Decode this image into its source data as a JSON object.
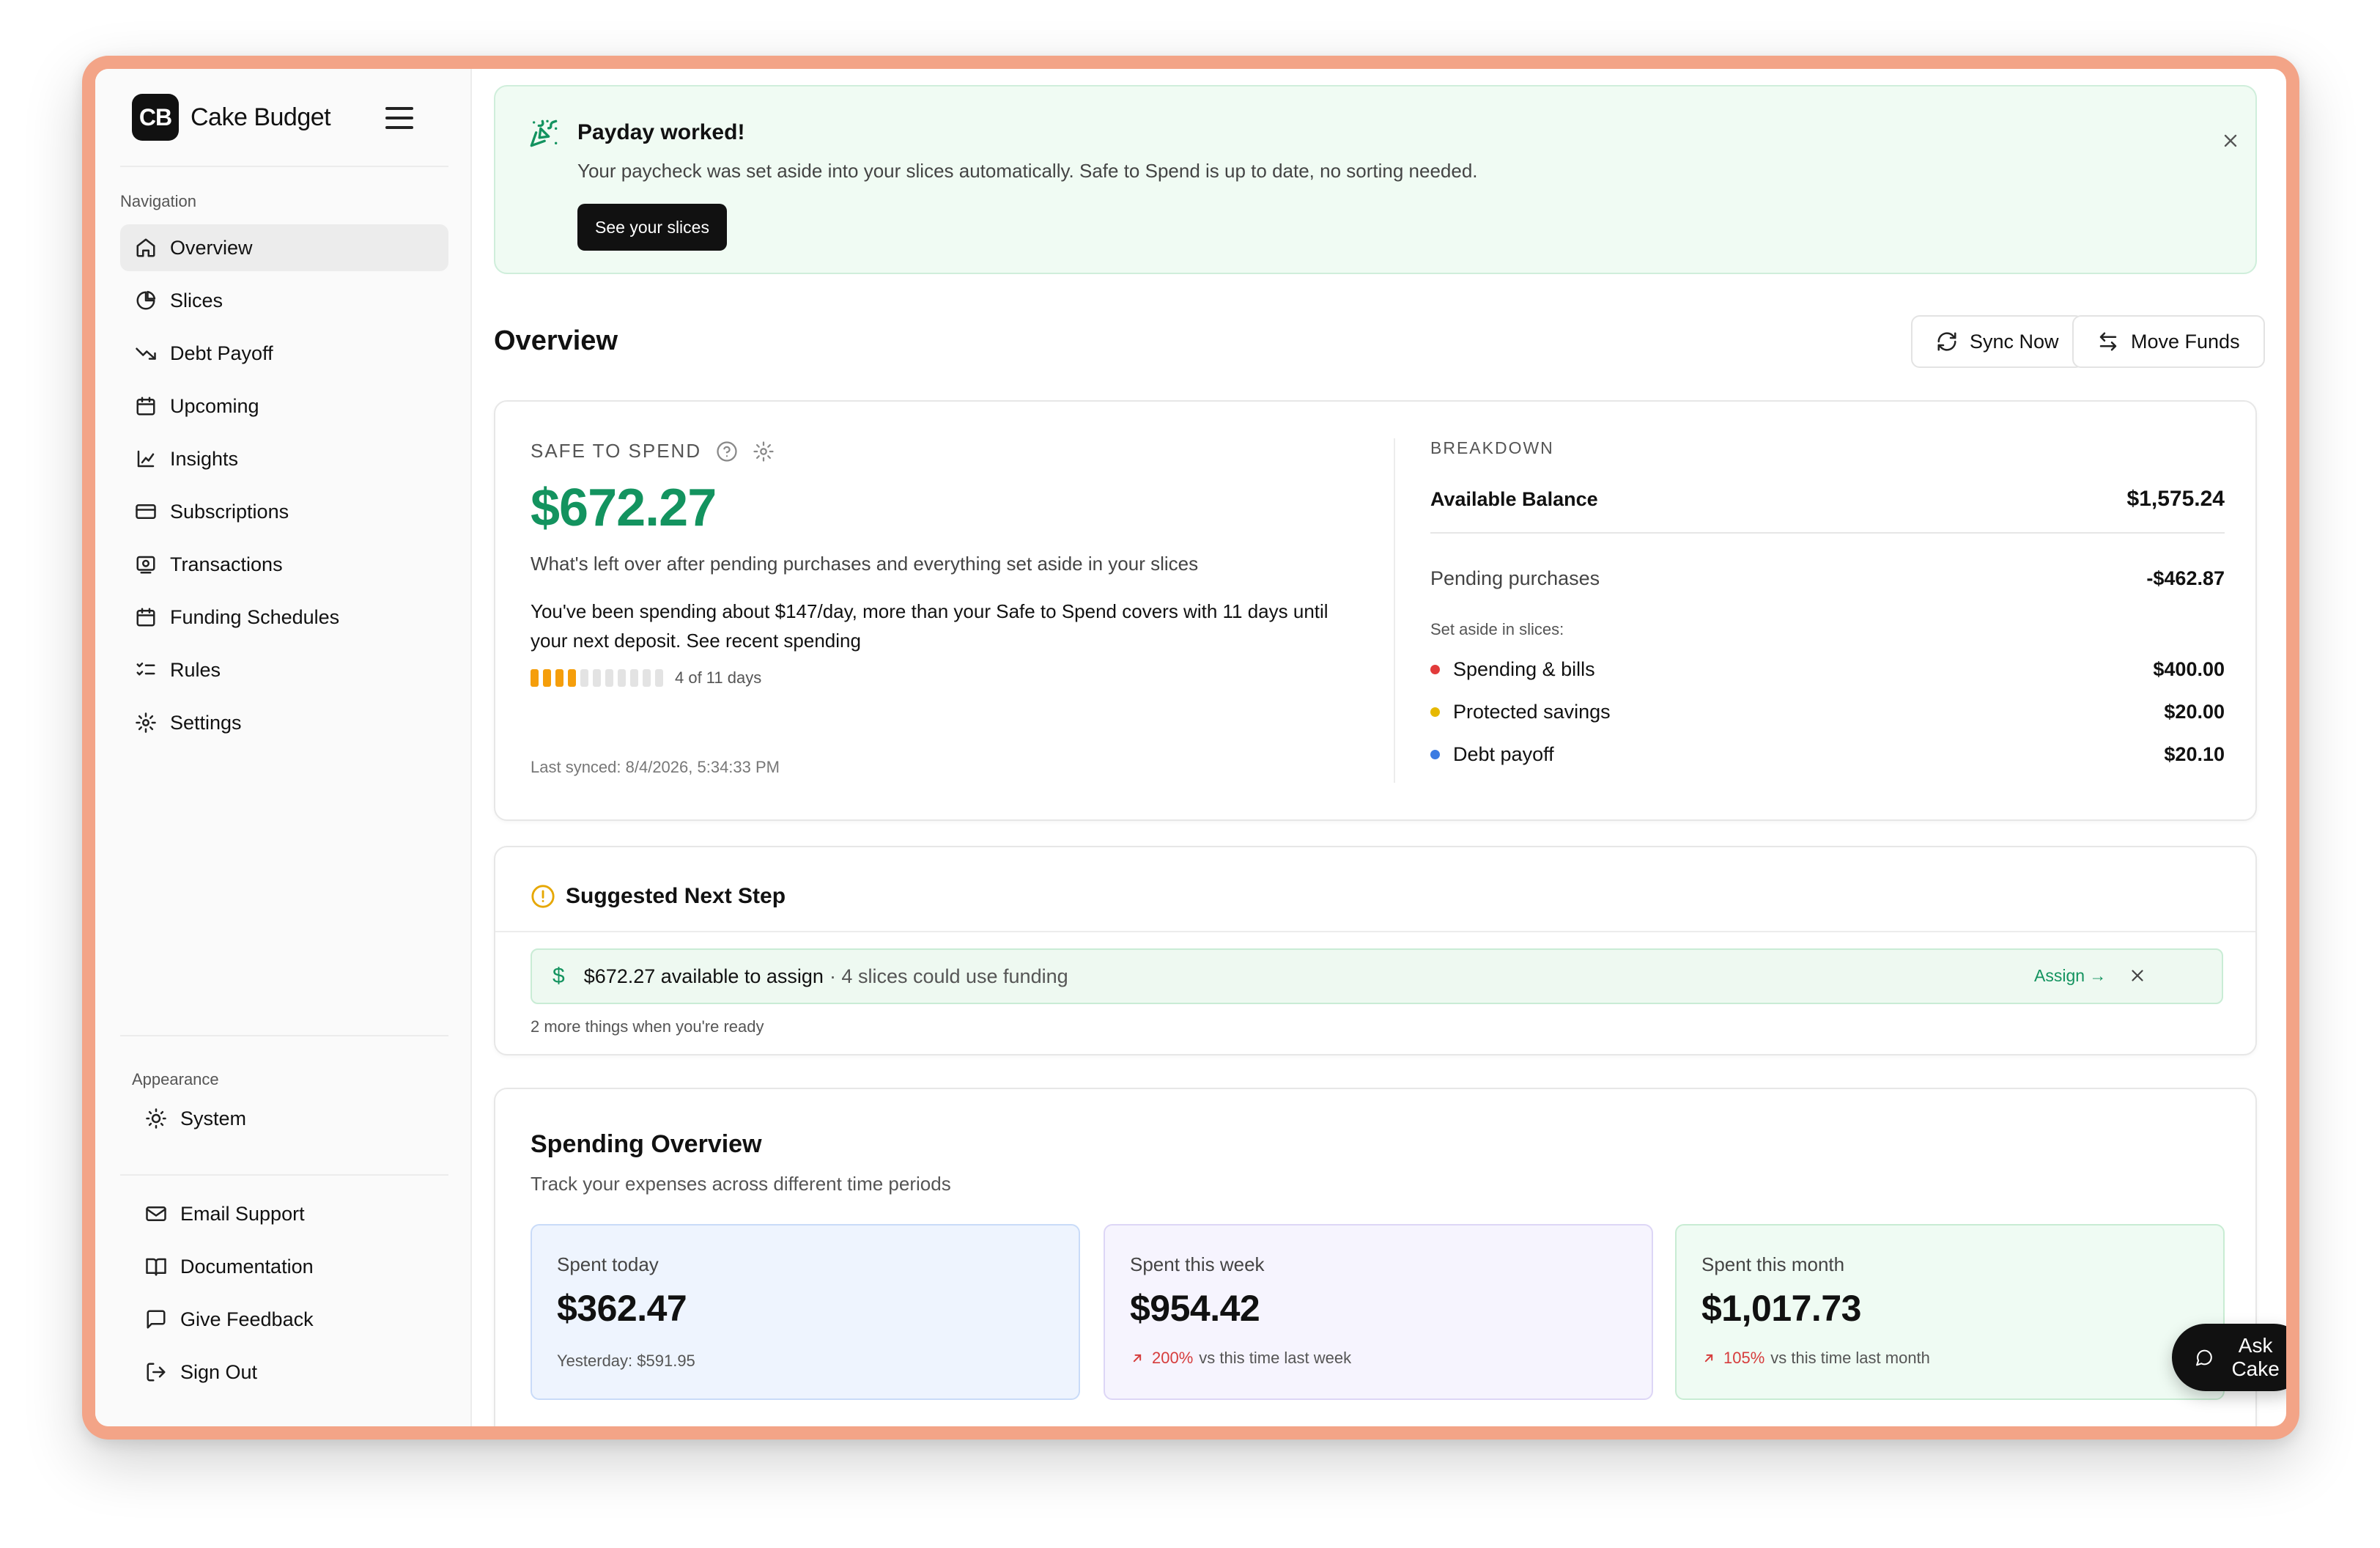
{
  "brand": {
    "logo_text": "CB",
    "name": "Cake Budget"
  },
  "sidebar": {
    "nav_label": "Navigation",
    "items": [
      {
        "label": "Overview",
        "icon": "home-icon"
      },
      {
        "label": "Slices",
        "icon": "pie-chart-icon"
      },
      {
        "label": "Debt Payoff",
        "icon": "trending-down-icon"
      },
      {
        "label": "Upcoming",
        "icon": "calendar-icon"
      },
      {
        "label": "Insights",
        "icon": "chart-icon"
      },
      {
        "label": "Subscriptions",
        "icon": "credit-card-icon"
      },
      {
        "label": "Transactions",
        "icon": "receipt-icon"
      },
      {
        "label": "Funding Schedules",
        "icon": "calendar-icon"
      },
      {
        "label": "Rules",
        "icon": "list-checks-icon"
      },
      {
        "label": "Settings",
        "icon": "gear-icon"
      }
    ],
    "appearance_label": "Appearance",
    "appearance_value": "System",
    "support": [
      {
        "label": "Email Support",
        "icon": "mail-icon"
      },
      {
        "label": "Documentation",
        "icon": "book-icon"
      },
      {
        "label": "Give Feedback",
        "icon": "message-square-icon"
      },
      {
        "label": "Sign Out",
        "icon": "log-out-icon"
      }
    ]
  },
  "banner": {
    "title": "Payday worked!",
    "text": "Your paycheck was set aside into your slices automatically. Safe to Spend is up to date, no sorting needed.",
    "button": "See your slices"
  },
  "header": {
    "title": "Overview",
    "sync_label": "Sync Now",
    "move_label": "Move Funds"
  },
  "safe_to_spend": {
    "label": "SAFE TO SPEND",
    "amount": "$672.27",
    "description": "What's left over after pending purchases and everything set aside in your slices",
    "warning": "You've been spending about $147/day, more than your Safe to Spend covers with 11 days until your next deposit. See recent spending",
    "progress_done": 4,
    "progress_total": 11,
    "progress_label": "4 of 11 days",
    "last_synced": "Last synced: 8/4/2026, 5:34:33 PM",
    "accent_color": "#13935f"
  },
  "breakdown": {
    "heading": "BREAKDOWN",
    "available_label": "Available Balance",
    "available_value": "$1,575.24",
    "pending_label": "Pending purchases",
    "pending_value": "-$462.87",
    "set_aside_label": "Set aside in slices:",
    "slices": [
      {
        "name": "Spending & bills",
        "value": "$400.00",
        "color": "#e23b3b"
      },
      {
        "name": "Protected savings",
        "value": "$20.00",
        "color": "#e6b800"
      },
      {
        "name": "Debt payoff",
        "value": "$20.10",
        "color": "#3b7be2"
      }
    ]
  },
  "next_step": {
    "title": "Suggested Next Step",
    "main": "$672.27 available to assign",
    "sub": "· 4 slices could use funding",
    "link": "Assign →",
    "more": "2 more things when you're ready"
  },
  "spending": {
    "title": "Spending Overview",
    "subtitle": "Track your expenses across different time periods",
    "cards": [
      {
        "label": "Spent today",
        "value": "$362.47",
        "foot": "Yesterday: $591.95"
      },
      {
        "label": "Spent this week",
        "value": "$954.42",
        "pct": "200%",
        "foot": "vs this time last week"
      },
      {
        "label": "Spent this month",
        "value": "$1,017.73",
        "pct": "105%",
        "foot": "vs this time last month"
      }
    ]
  },
  "ask_label": "Ask Cake"
}
